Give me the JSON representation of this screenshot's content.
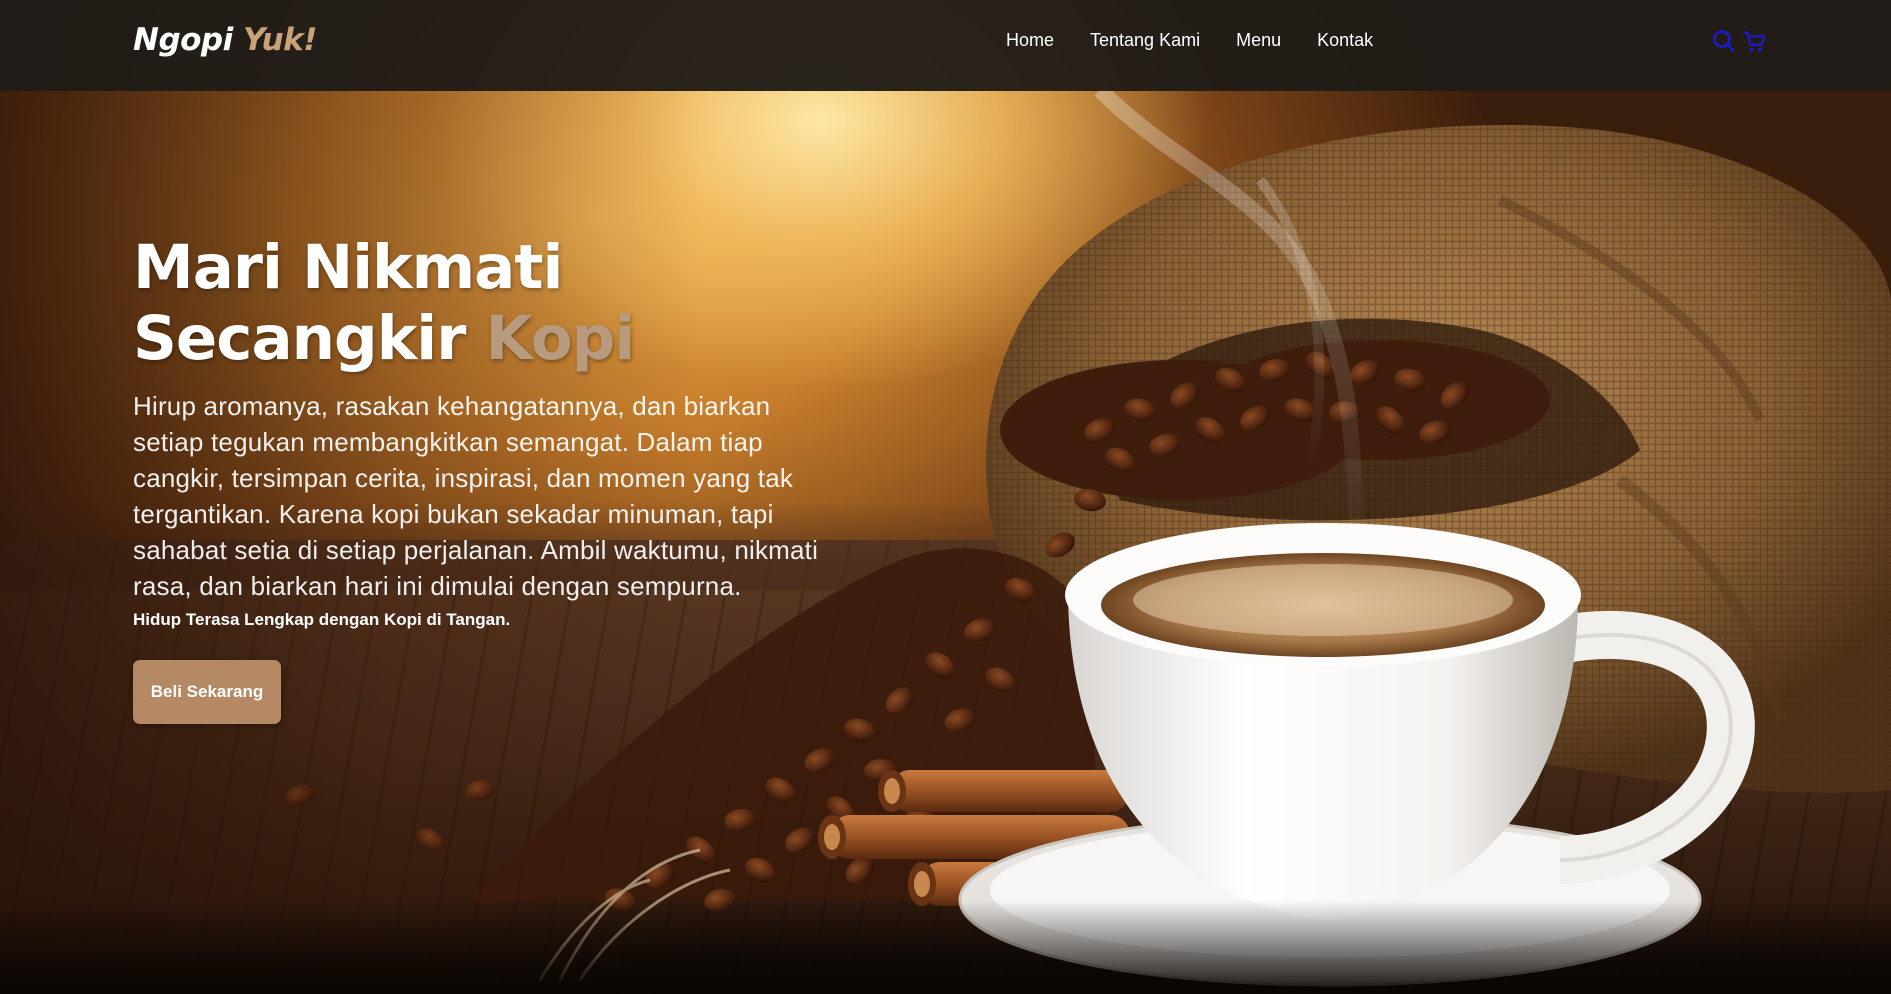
{
  "navbar": {
    "logo": {
      "primary": "Ngopi",
      "accent": "Yuk!"
    },
    "links": [
      {
        "label": "Home"
      },
      {
        "label": "Tentang Kami"
      },
      {
        "label": "Menu"
      },
      {
        "label": "Kontak"
      }
    ],
    "icons": {
      "search": "search-icon",
      "cart": "cart-icon"
    }
  },
  "hero": {
    "title_line1": "Mari Nikmati",
    "title_line2": "Secangkir",
    "title_accent": "Kopi",
    "description": "Hirup aromanya, rasakan kehangatannya, dan biarkan setiap tegukan membangkitkan semangat. Dalam tiap cangkir, tersimpan cerita, inspirasi, dan momen yang tak tergantikan. Karena kopi bukan sekadar minuman, tapi sahabat setia di setiap perjalanan. Ambil waktumu, nikmati rasa, dan biarkan hari ini dimulai dengan sempurna.",
    "tagline": "Hidup Terasa Lengkap dengan Kopi di Tangan.",
    "cta_label": "Beli Sekarang"
  },
  "colors": {
    "navbar_bg": "#201c18",
    "accent": "#b89a7e",
    "button": "#b48964",
    "icon_color": "#1a1adb"
  }
}
